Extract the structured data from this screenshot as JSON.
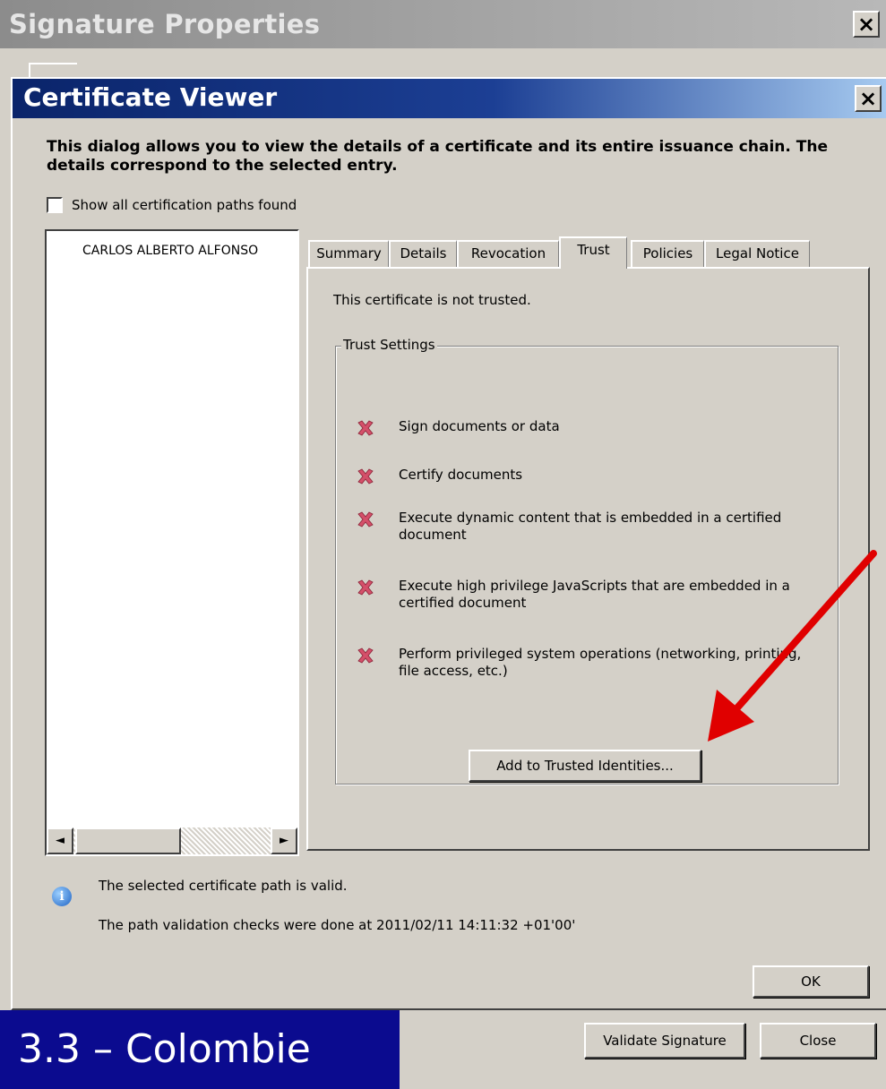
{
  "outer_window": {
    "title": "Signature Properties",
    "close_label": "×",
    "buttons": {
      "validate": "Validate Signature",
      "close": "Close"
    }
  },
  "dialog": {
    "title": "Certificate Viewer",
    "close_label": "×",
    "intro": "This dialog allows you to view the details of a certificate and its entire issuance chain. The details correspond to the selected entry.",
    "show_all_paths_label": "Show all certification paths found",
    "show_all_paths_checked": false,
    "cert_list": {
      "items": [
        "CARLOS ALBERTO ALFONSO"
      ]
    },
    "scroll": {
      "left_glyph": "◄",
      "right_glyph": "►"
    },
    "tabs": [
      {
        "label": "Summary",
        "active": false
      },
      {
        "label": "Details",
        "active": false
      },
      {
        "label": "Revocation",
        "active": false
      },
      {
        "label": "Trust",
        "active": true
      },
      {
        "label": "Policies",
        "active": false
      },
      {
        "label": "Legal Notice",
        "active": false
      }
    ],
    "trust_tab": {
      "status": "This certificate is not trusted.",
      "group_title": "Trust Settings",
      "items": [
        {
          "text": "Sign documents or data",
          "icon": "x-mark-icon"
        },
        {
          "text": "Certify documents",
          "icon": "x-mark-icon"
        },
        {
          "text": "Execute dynamic content that is embedded in a certified document",
          "icon": "x-mark-icon"
        },
        {
          "text": "Execute high privilege JavaScripts that are embedded in a certified document",
          "icon": "x-mark-icon"
        },
        {
          "text": "Perform privileged system operations (networking, printing, file access, etc.)",
          "icon": "x-mark-icon"
        }
      ],
      "add_button": "Add to Trusted Identities..."
    },
    "info": {
      "icon": "info-icon",
      "icon_glyph": "i",
      "line1": "The selected certificate path is valid.",
      "line2": "The path validation checks were done at 2011/02/11 14:11:32 +01'00'"
    },
    "ok_button": "OK"
  },
  "slide_label": "3.3 – Colombie",
  "colors": {
    "titlebar_active": "#0a246a",
    "titlebar_inactive": "#8c8c8c",
    "window_bg": "#d4d0c8",
    "x_mark": "#d4506a",
    "arrow": "#e00000",
    "slide_label_bg": "#0b0b8f"
  }
}
